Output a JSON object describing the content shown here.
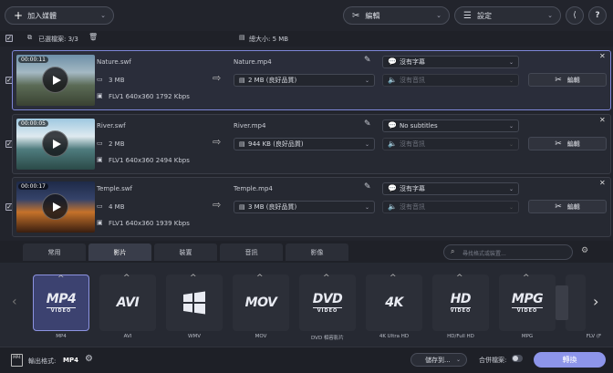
{
  "toolbar": {
    "add_media": "加入媒體",
    "edit": "編輯",
    "settings": "設定"
  },
  "selection": {
    "selected_files": "已選檔案: 3/3",
    "total_size": "總大小: 5 MB"
  },
  "files": [
    {
      "duration": "00:00:11",
      "source": "Nature.swf",
      "size": "3 MB",
      "info": "FLV1 640x360 1792 Kbps",
      "output": "Nature.mp4",
      "output_size": "2 MB (良好品質)",
      "subtitles": "沒有字幕",
      "audio": "沒有音訊",
      "edit": "編輯"
    },
    {
      "duration": "00:00:05",
      "source": "River.swf",
      "size": "2 MB",
      "info": "FLV1 640x360 2494 Kbps",
      "output": "River.mp4",
      "output_size": "944 KB (良好品質)",
      "subtitles": "No subtitles",
      "audio": "沒有音訊",
      "edit": "編輯"
    },
    {
      "duration": "00:00:17",
      "source": "Temple.swf",
      "size": "4 MB",
      "info": "FLV1 640x360 1939 Kbps",
      "output": "Temple.mp4",
      "output_size": "3 MB (良好品質)",
      "subtitles": "沒有字幕",
      "audio": "沒有音訊",
      "edit": "編輯"
    }
  ],
  "tabs": [
    "常用",
    "影片",
    "裝置",
    "音訊",
    "影像"
  ],
  "search": {
    "placeholder": "尋找格式或裝置..."
  },
  "formats": [
    {
      "logo": "MP4",
      "sub": "VIDEO",
      "label": "MP4"
    },
    {
      "logo": "AVI",
      "sub": "",
      "label": "AVI"
    },
    {
      "logo": "",
      "sub": "",
      "label": "WMV"
    },
    {
      "logo": "MOV",
      "sub": "",
      "label": "MOV"
    },
    {
      "logo": "DVD",
      "sub": "VIDEO",
      "label": "DVD 相容影片"
    },
    {
      "logo": "4K",
      "sub": "",
      "label": "4K Ultra HD"
    },
    {
      "logo": "HD",
      "sub": "VIDEO",
      "label": "HD/Full HD"
    },
    {
      "logo": "MPG",
      "sub": "VIDEO",
      "label": "MPG"
    },
    {
      "logo": "",
      "sub": "",
      "label": "FLV (F"
    }
  ],
  "footer": {
    "output_format_label": "輸出格式:",
    "output_format": "MP4",
    "save_to": "儲存到...",
    "merge": "合併檔案:",
    "convert": "轉換"
  },
  "colors": {
    "accent": "#7e86d8",
    "convert_bg": "#8d95ea",
    "background": "#22242c"
  }
}
